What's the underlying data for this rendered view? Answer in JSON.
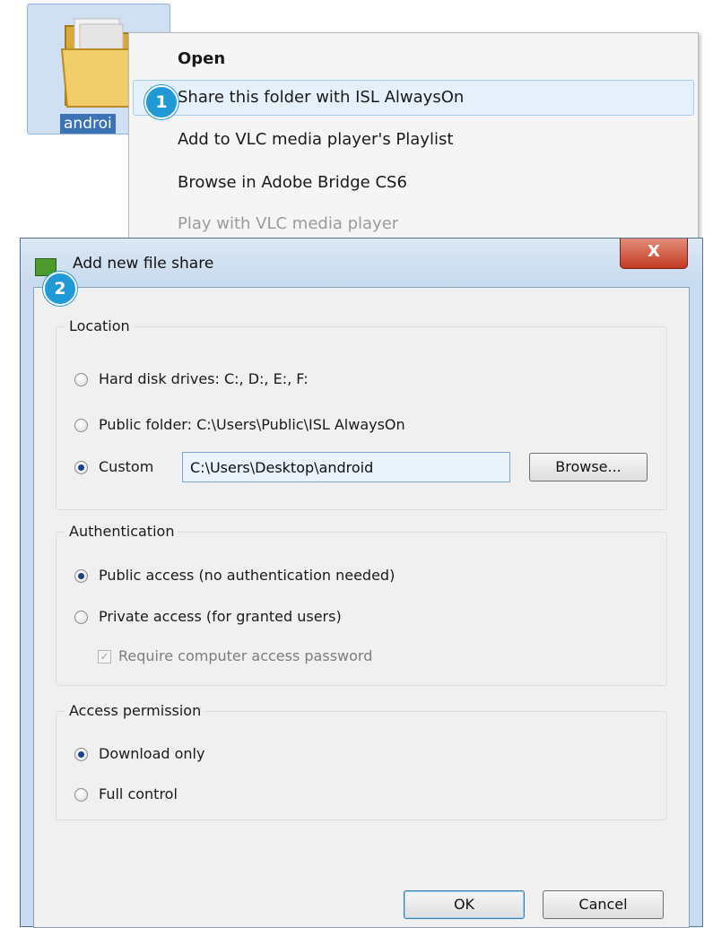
{
  "desktop": {
    "folder_label": "androi"
  },
  "badges": {
    "step1": "1",
    "step2": "2"
  },
  "context_menu": {
    "items": [
      {
        "label": "Open"
      },
      {
        "label": "Share this folder with ISL AlwaysOn"
      },
      {
        "label": "Add to VLC media player's Playlist"
      },
      {
        "label": "Browse in Adobe Bridge CS6"
      },
      {
        "label": "Play with VLC media player"
      }
    ]
  },
  "dialog": {
    "title": "Add new file share",
    "close_label": "X",
    "location": {
      "group_label": "Location",
      "options": [
        {
          "label": "Hard disk drives: C:, D:, E:, F:",
          "checked": false
        },
        {
          "label": "Public folder: C:\\Users\\Public\\ISL AlwaysOn",
          "checked": false
        },
        {
          "label": "Custom",
          "checked": true
        }
      ],
      "custom_path": "C:\\Users\\Desktop\\android",
      "browse_label": "Browse..."
    },
    "authentication": {
      "group_label": "Authentication",
      "options": [
        {
          "label": "Public access (no authentication needed)",
          "checked": true
        },
        {
          "label": "Private access (for granted users)",
          "checked": false
        }
      ],
      "require_password_label": "Require computer access password",
      "require_password_checked": true
    },
    "access_permission": {
      "group_label": "Access permission",
      "options": [
        {
          "label": "Download only",
          "checked": true
        },
        {
          "label": "Full control",
          "checked": false
        }
      ]
    },
    "ok_label": "OK",
    "cancel_label": "Cancel"
  },
  "colors": {
    "badge": "#1f9ad6",
    "menu_highlight": "#e6f0fb",
    "close_button": "#c23b22",
    "dialog_frame": "#c9dcef"
  }
}
